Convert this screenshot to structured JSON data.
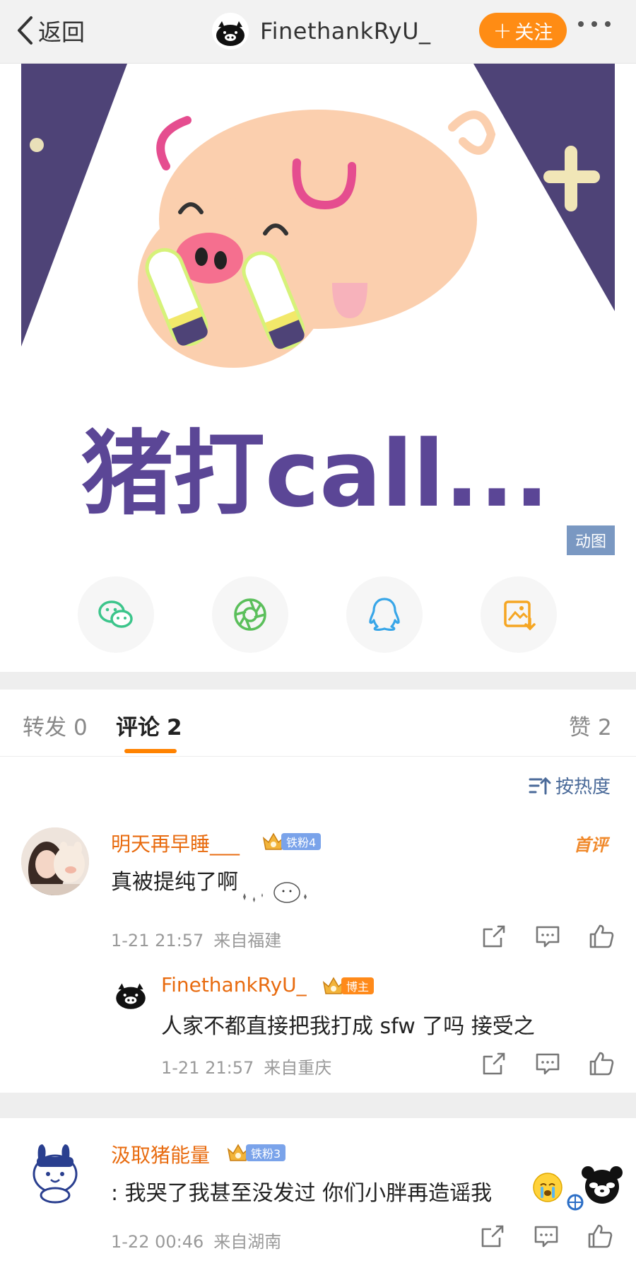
{
  "nav": {
    "back_label": "返回",
    "username": "FinethankRyU_",
    "follow_label": "关注",
    "follow_plus": "+",
    "accent_color": "#ff8c14"
  },
  "post": {
    "gif_caption": "猪打call...",
    "gif_badge": "动图"
  },
  "share": [
    {
      "name": "wechat-icon",
      "color": "#3cc58b"
    },
    {
      "name": "moments-icon",
      "color": "#5bbf5b"
    },
    {
      "name": "qq-icon",
      "color": "#38a6e8"
    },
    {
      "name": "save-image-icon",
      "color": "#f5a623"
    }
  ],
  "tabs": {
    "repost_label": "转发",
    "repost_count": "0",
    "comment_label": "评论",
    "comment_count": "2",
    "like_label": "赞",
    "like_count": "2"
  },
  "sort_label": "按热度",
  "comments": [
    {
      "username": "明天再早睡___",
      "badge": "铁粉4",
      "first_tag": "首评",
      "text": "真被提纯了啊",
      "date": "1-21 21:57",
      "location": "来自福建",
      "reply": {
        "username": "FinethankRyU_",
        "badge": "博主",
        "text": "人家不都直接把我打成 sfw 了吗 接受之",
        "date": "1-21 21:57",
        "location": "来自重庆"
      }
    },
    {
      "username": "汲取猪能量",
      "badge": "铁粉3",
      "text": ": 我哭了我甚至没发过 你们小胖再造谣我",
      "date": "1-22 00:46",
      "location": "来自湖南"
    }
  ],
  "colors": {
    "username": "#e86b0f",
    "link_blue": "#4a6a99",
    "fan_badge": "#7aa3ea",
    "host_badge": "#ff8a1a"
  }
}
